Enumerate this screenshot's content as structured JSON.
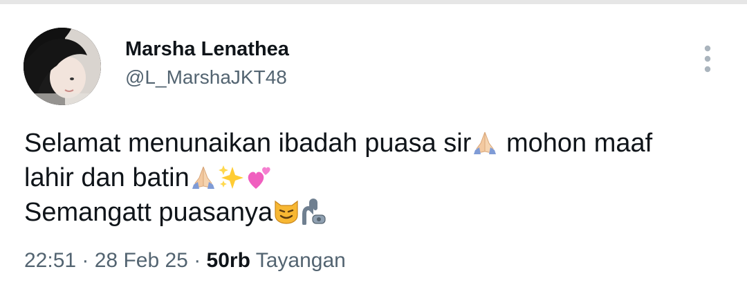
{
  "author": {
    "display_name": "Marsha Lenathea",
    "handle": "@L_MarshaJKT48"
  },
  "icons": {
    "more": "vertical-ellipsis-icon",
    "pray": "folded-hands-emoji",
    "sparkles": "sparkles-emoji",
    "hearts": "two-hearts-emoji",
    "cat": "grinning-cat-emoji",
    "arm": "mechanical-arm-emoji"
  },
  "tweet": {
    "line1_text": "Selamat menunaikan ibadah puasa sir",
    "line1_tail": " mohon maaf",
    "line2_text": "lahir dan batin",
    "line3_text": "Semangatt puasanya"
  },
  "meta": {
    "time": "22:51",
    "separator1": " · ",
    "date": "28 Feb 25",
    "separator2": " · ",
    "views_count": "50rb",
    "views_label": " Tayangan"
  },
  "colors": {
    "text_primary": "#0f1419",
    "text_secondary": "#536471",
    "icon_gray": "#aab4bd"
  }
}
